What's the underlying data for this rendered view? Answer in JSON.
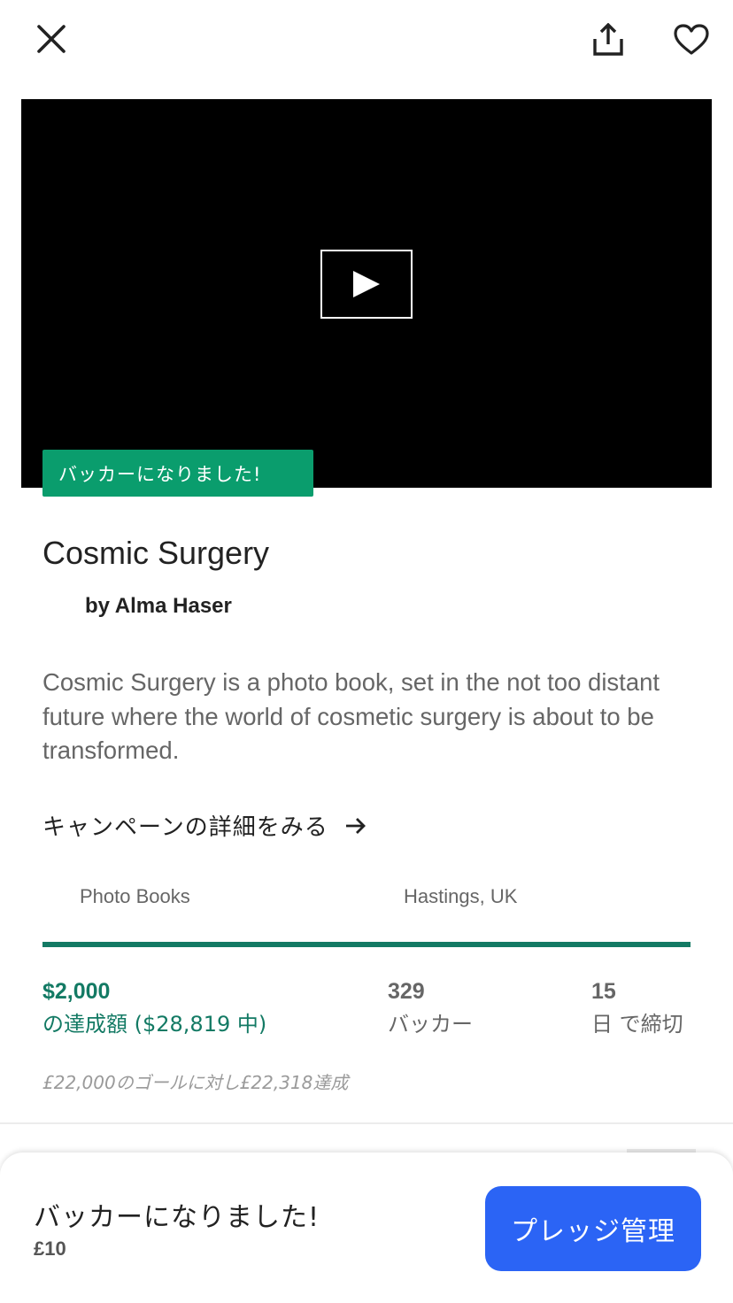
{
  "project": {
    "title": "Cosmic Surgery",
    "creator": "by Alma Haser",
    "blurb": "Cosmic Surgery is a photo book, set in the not too distant future where the world of cosmetic surgery is about to be transformed.",
    "badge": "バッカーになりました!",
    "details_link": "キャンペーンの詳細をみる",
    "category": "Photo Books",
    "location": "Hastings, UK"
  },
  "stats": {
    "progress": 1.0,
    "pledged": "$2,000",
    "pledged_label": "の達成額 ($28,819 中)",
    "backers": "329",
    "backers_label": "バッカー",
    "days": "15",
    "days_label": "日 で締切",
    "goal_note": "£22,000のゴールに対し£22,318達成"
  },
  "bottom_bar": {
    "status": "バッカーになりました!",
    "amount": "£10",
    "manage_button": "プレッジ管理"
  },
  "colors": {
    "accent_green": "#0a9d6d",
    "progress_green": "#137a64",
    "button_blue": "#2b64f5"
  },
  "icons": [
    "close-icon",
    "share-icon",
    "heart-icon",
    "play-icon",
    "arrow-right-icon"
  ]
}
